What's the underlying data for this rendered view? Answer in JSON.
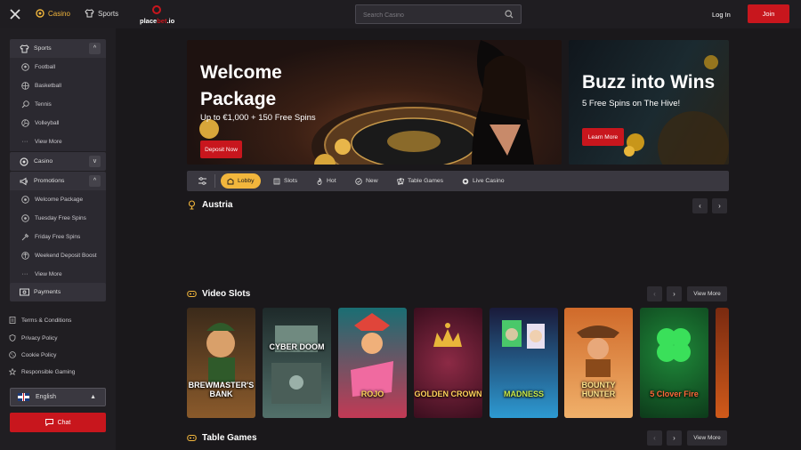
{
  "topbar": {
    "casino_label": "Casino",
    "sports_label": "Sports",
    "logo_part1": "place",
    "logo_part2": "bet",
    "logo_part3": ".io",
    "search_placeholder": "Search Casino",
    "login_label": "Log In",
    "join_label": "Join"
  },
  "sidebar": {
    "sports": {
      "label": "Sports",
      "toggle": "^",
      "items": [
        {
          "label": "Football",
          "icon": "football-icon"
        },
        {
          "label": "Basketball",
          "icon": "basketball-icon"
        },
        {
          "label": "Tennis",
          "icon": "tennis-icon"
        },
        {
          "label": "Volleyball",
          "icon": "volleyball-icon"
        },
        {
          "label": "View More",
          "icon": "more-icon"
        }
      ]
    },
    "casino": {
      "label": "Casino",
      "toggle": "v"
    },
    "promotions": {
      "label": "Promotions",
      "toggle": "^",
      "items": [
        {
          "label": "Welcome Package"
        },
        {
          "label": "Tuesday Free Spins"
        },
        {
          "label": "Friday Free Spins"
        },
        {
          "label": "Weekend Deposit Boost"
        },
        {
          "label": "View More"
        }
      ]
    },
    "payments": {
      "label": "Payments"
    },
    "footer_links": [
      {
        "label": "Terms & Conditions"
      },
      {
        "label": "Privacy Policy"
      },
      {
        "label": "Cookie Policy"
      },
      {
        "label": "Responsible Gaming"
      }
    ],
    "language": "English",
    "chat_label": "Chat"
  },
  "banners": [
    {
      "title": "Welcome Package",
      "subtitle": "Up to €1,000 + 150 Free Spins",
      "button": "Deposit Now"
    },
    {
      "title": "Buzz into Wins",
      "subtitle": "5 Free Spins on The Hive!",
      "button": "Learn More"
    }
  ],
  "tabs": [
    {
      "label": "Lobby",
      "active": true,
      "icon": "lobby-icon"
    },
    {
      "label": "Slots",
      "active": false,
      "icon": "slots-icon"
    },
    {
      "label": "Hot",
      "active": false,
      "icon": "flame-icon"
    },
    {
      "label": "New",
      "active": false,
      "icon": "new-icon"
    },
    {
      "label": "Table Games",
      "active": false,
      "icon": "cards-icon"
    },
    {
      "label": "Live Casino",
      "active": false,
      "icon": "live-icon"
    }
  ],
  "sections": {
    "austria": {
      "title": "Austria"
    },
    "video_slots": {
      "title": "Video Slots",
      "view_more": "View More",
      "games": [
        {
          "name": "BREWMASTER'S BANK",
          "colors": [
            "#3b2a1a",
            "#8a5a2b"
          ]
        },
        {
          "name": "CYBER DOOM",
          "colors": [
            "#1e2a2a",
            "#52706a"
          ]
        },
        {
          "name": "ROJO",
          "colors": [
            "#1a6e73",
            "#c23a55"
          ]
        },
        {
          "name": "GOLDEN CROWN",
          "colors": [
            "#3a0e1e",
            "#8c2a45"
          ]
        },
        {
          "name": "MADNESS",
          "colors": [
            "#1a1a3a",
            "#2d9ad2"
          ]
        },
        {
          "name": "BOUNTY HUNTER",
          "colors": [
            "#d06a2a",
            "#f0b06a"
          ]
        },
        {
          "name": "5 Clover Fire",
          "colors": [
            "#0d3a1a",
            "#1f8a3a"
          ]
        },
        {
          "name": "",
          "colors": [
            "#7a2a10",
            "#d05a1a"
          ]
        }
      ]
    },
    "table_games": {
      "title": "Table Games",
      "view_more": "View More"
    }
  },
  "colors": {
    "accent": "#f2b63c",
    "brand_red": "#c8161d",
    "background": "#1a181b"
  }
}
